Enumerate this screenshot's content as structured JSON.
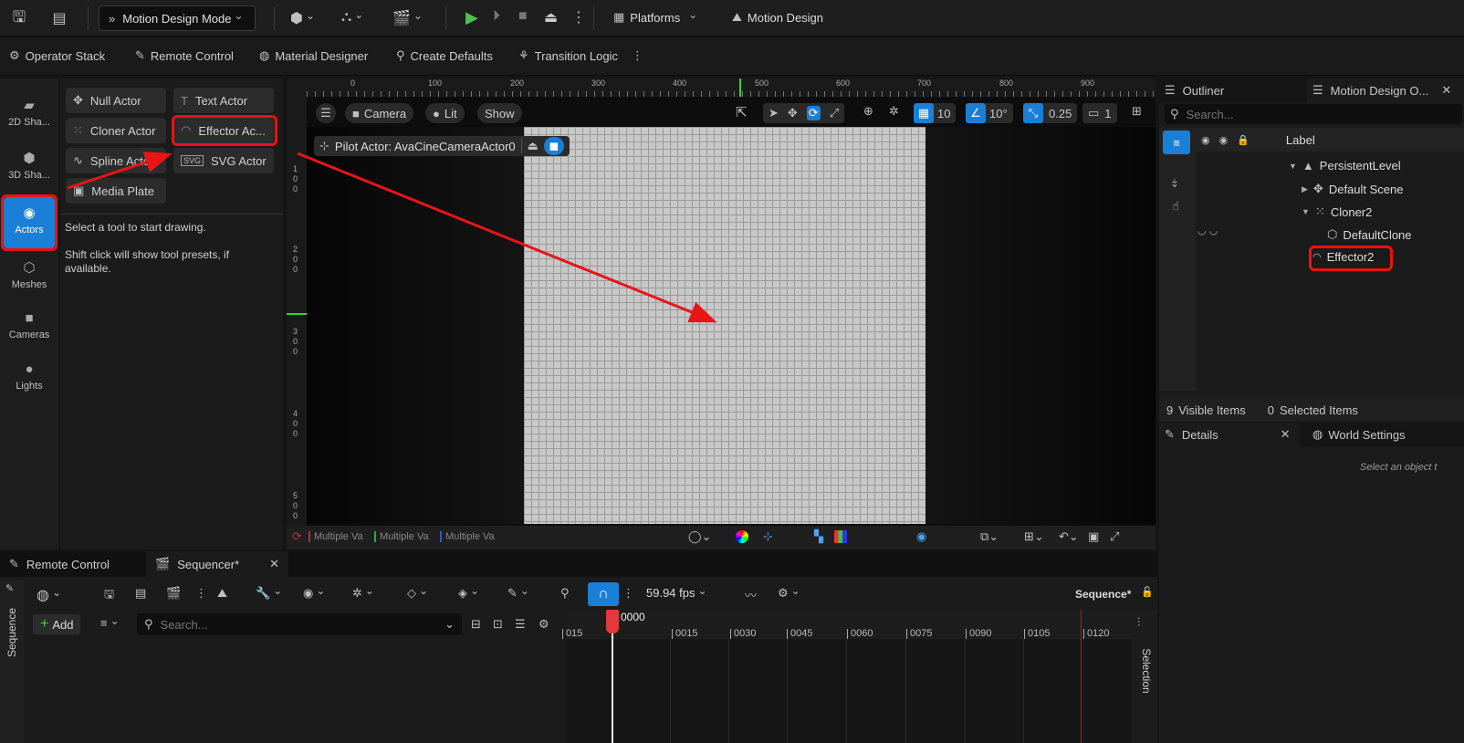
{
  "toolbar": {
    "mode_label": "Motion Design Mode",
    "platforms_label": "Platforms",
    "motion_design_label": "Motion Design"
  },
  "toolbar2": {
    "items": [
      "Operator Stack",
      "Remote Control",
      "Material Designer",
      "Create Defaults",
      "Transition Logic"
    ]
  },
  "modes": [
    {
      "label": "2D Sha...",
      "icon": "2d-shapes-icon"
    },
    {
      "label": "3D Sha...",
      "icon": "3d-shapes-icon"
    },
    {
      "label": "Actors",
      "icon": "actors-icon"
    },
    {
      "label": "Meshes",
      "icon": "meshes-icon"
    },
    {
      "label": "Cameras",
      "icon": "cameras-icon"
    },
    {
      "label": "Lights",
      "icon": "lights-icon"
    }
  ],
  "place": {
    "null_actor": "Null Actor",
    "text_actor": "Text Actor",
    "cloner_actor": "Cloner Actor",
    "effector_actor": "Effector Ac...",
    "spline_actor": "Spline Actor",
    "svg_actor": "SVG Actor",
    "svg_badge": "SVG",
    "media_plate": "Media Plate",
    "hint1": "Select a tool to start drawing.",
    "hint2": "Shift click will show tool presets, if available."
  },
  "viewport": {
    "camera": "Camera",
    "lit": "Lit",
    "show": "Show",
    "grid_snap": "10",
    "rot_snap": "10°",
    "scale_snap": "0.25",
    "cam_speed": "1",
    "pilot": "Pilot Actor: AvaCineCameraActor0",
    "ruler_h": [
      "0",
      "100",
      "200",
      "300",
      "400",
      "500",
      "600",
      "700",
      "800",
      "900"
    ],
    "ruler_v": [
      [
        "1",
        "0",
        "0"
      ],
      [
        "2",
        "0",
        "0"
      ],
      [
        "3",
        "0",
        "0"
      ],
      [
        "4",
        "0",
        "0"
      ],
      [
        "5",
        "0",
        "0"
      ]
    ],
    "multi": [
      "Multiple Va",
      "Multiple Va",
      "Multiple Va"
    ]
  },
  "outliner": {
    "tab1": "Outliner",
    "tab2": "Motion Design O...",
    "search_placeholder": "Search...",
    "label_col": "Label",
    "rows": [
      "PersistentLevel",
      "Default Scene",
      "Cloner2",
      "DefaultClone",
      "Effector2"
    ],
    "visible_count": "9",
    "visible_label": "Visible Items",
    "selected_count": "0",
    "selected_label": "Selected Items"
  },
  "details": {
    "tab1": "Details",
    "tab2": "World Settings",
    "empty": "Select an object t"
  },
  "sequencer": {
    "tab1": "Remote Control",
    "tab2": "Sequencer*",
    "vert_label": "Sequence",
    "add": "Add",
    "search_placeholder": "Search...",
    "fps": "59.94 fps",
    "seq_name": "Sequence*",
    "playhead": "0000",
    "ticks": [
      "015",
      "0015",
      "0030",
      "0045",
      "0060",
      "0075",
      "0090",
      "0105",
      "0120"
    ],
    "selection_label": "Selection"
  }
}
